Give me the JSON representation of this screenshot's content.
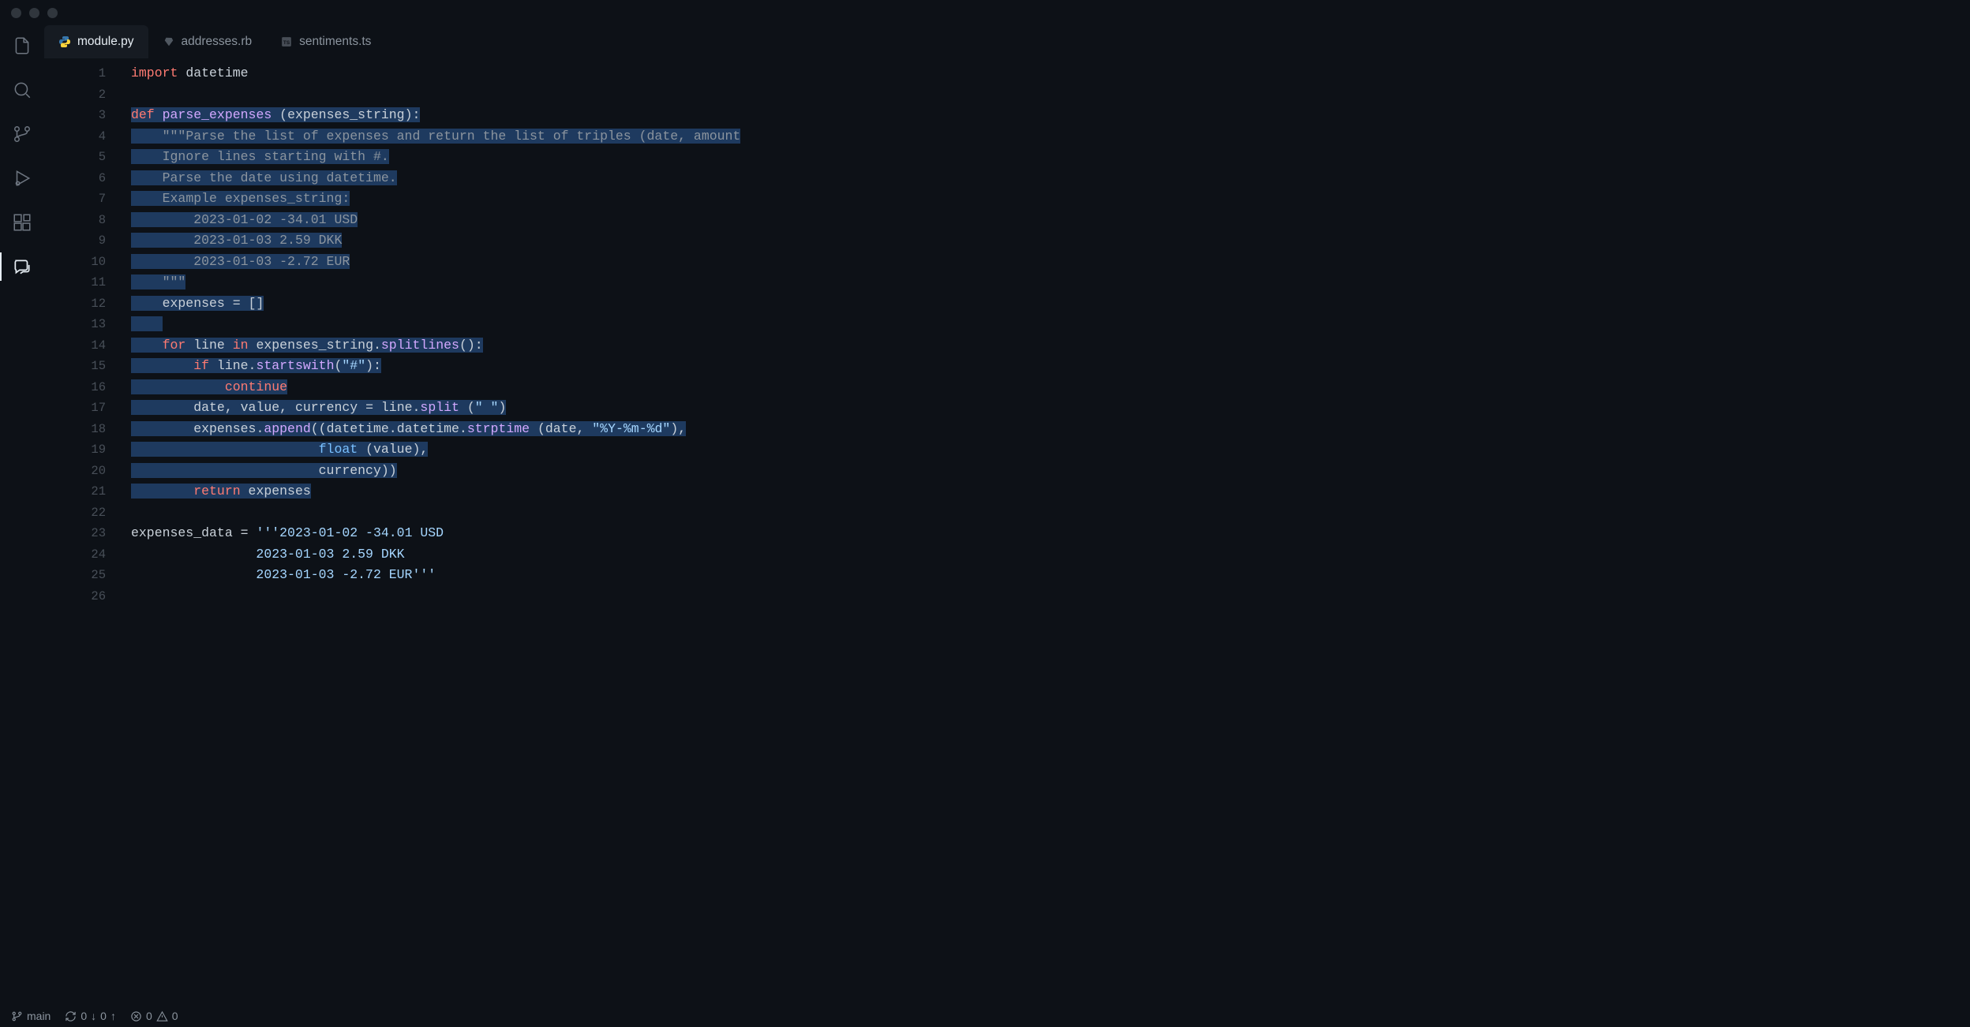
{
  "tabs": [
    {
      "label": "module.py",
      "icon": "python",
      "active": true
    },
    {
      "label": "addresses.rb",
      "icon": "ruby",
      "active": false
    },
    {
      "label": "sentiments.ts",
      "icon": "typescript",
      "active": false
    }
  ],
  "activity": {
    "items": [
      "files",
      "search",
      "source-control",
      "debug",
      "extensions",
      "chat"
    ],
    "active": "chat"
  },
  "code": {
    "lines": [
      {
        "n": 1,
        "sel": false,
        "tokens": [
          [
            "kw",
            "import"
          ],
          [
            "id",
            " datetime"
          ]
        ]
      },
      {
        "n": 2,
        "sel": false,
        "tokens": []
      },
      {
        "n": 3,
        "sel": true,
        "tokens": [
          [
            "kw",
            "def"
          ],
          [
            "id",
            " "
          ],
          [
            "def",
            "parse_expenses"
          ],
          [
            "id",
            " "
          ],
          [
            "op",
            "("
          ],
          [
            "id",
            "expenses_string"
          ],
          [
            "op",
            "):"
          ]
        ]
      },
      {
        "n": 4,
        "sel": true,
        "tokens": [
          [
            "id",
            "    "
          ],
          [
            "docstr",
            "\"\"\"Parse the list of expenses and return the list of triples (date, amount"
          ]
        ]
      },
      {
        "n": 5,
        "sel": true,
        "tokens": [
          [
            "id",
            "    "
          ],
          [
            "docstr",
            "Ignore lines starting with #."
          ]
        ]
      },
      {
        "n": 6,
        "sel": true,
        "tokens": [
          [
            "id",
            "    "
          ],
          [
            "docstr",
            "Parse the date using datetime."
          ]
        ]
      },
      {
        "n": 7,
        "sel": true,
        "tokens": [
          [
            "id",
            "    "
          ],
          [
            "docstr",
            "Example expenses_string:"
          ]
        ]
      },
      {
        "n": 8,
        "sel": true,
        "tokens": [
          [
            "id",
            "        "
          ],
          [
            "docstr",
            "2023-01-02 -34.01 USD"
          ]
        ]
      },
      {
        "n": 9,
        "sel": true,
        "tokens": [
          [
            "id",
            "        "
          ],
          [
            "docstr",
            "2023-01-03 2.59 DKK"
          ]
        ]
      },
      {
        "n": 10,
        "sel": true,
        "tokens": [
          [
            "id",
            "        "
          ],
          [
            "docstr",
            "2023-01-03 -2.72 EUR"
          ]
        ]
      },
      {
        "n": 11,
        "sel": true,
        "tokens": [
          [
            "id",
            "    "
          ],
          [
            "docstr",
            "\"\"\""
          ]
        ]
      },
      {
        "n": 12,
        "sel": true,
        "tokens": [
          [
            "id",
            "    expenses "
          ],
          [
            "op",
            "="
          ],
          [
            "id",
            " "
          ],
          [
            "op",
            "[]"
          ]
        ]
      },
      {
        "n": 13,
        "sel": true,
        "tokens": [
          [
            "id",
            "    "
          ]
        ]
      },
      {
        "n": 14,
        "sel": true,
        "tokens": [
          [
            "id",
            "    "
          ],
          [
            "kw",
            "for"
          ],
          [
            "id",
            " line "
          ],
          [
            "kw",
            "in"
          ],
          [
            "id",
            " expenses_string"
          ],
          [
            "op",
            "."
          ],
          [
            "fn",
            "splitlines"
          ],
          [
            "op",
            "():"
          ]
        ]
      },
      {
        "n": 15,
        "sel": true,
        "tokens": [
          [
            "id",
            "        "
          ],
          [
            "kw",
            "if"
          ],
          [
            "id",
            " line"
          ],
          [
            "op",
            "."
          ],
          [
            "fn",
            "startswith"
          ],
          [
            "op",
            "("
          ],
          [
            "str",
            "\"#\""
          ],
          [
            "op",
            "):"
          ]
        ]
      },
      {
        "n": 16,
        "sel": true,
        "tokens": [
          [
            "id",
            "            "
          ],
          [
            "kw",
            "continue"
          ]
        ]
      },
      {
        "n": 17,
        "sel": true,
        "tokens": [
          [
            "id",
            "        date"
          ],
          [
            "op",
            ","
          ],
          [
            "id",
            " value"
          ],
          [
            "op",
            ","
          ],
          [
            "id",
            " currency "
          ],
          [
            "op",
            "="
          ],
          [
            "id",
            " line"
          ],
          [
            "op",
            "."
          ],
          [
            "fn",
            "split"
          ],
          [
            "id",
            " "
          ],
          [
            "op",
            "("
          ],
          [
            "str",
            "\" \""
          ],
          [
            "op",
            ")"
          ]
        ]
      },
      {
        "n": 18,
        "sel": true,
        "tokens": [
          [
            "id",
            "        expenses"
          ],
          [
            "op",
            "."
          ],
          [
            "fn",
            "append"
          ],
          [
            "op",
            "(("
          ],
          [
            "id",
            "datetime"
          ],
          [
            "op",
            "."
          ],
          [
            "id",
            "datetime"
          ],
          [
            "op",
            "."
          ],
          [
            "fn",
            "strptime"
          ],
          [
            "id",
            " "
          ],
          [
            "op",
            "("
          ],
          [
            "id",
            "date"
          ],
          [
            "op",
            ", "
          ],
          [
            "str",
            "\"%Y-%m-%d\""
          ],
          [
            "op",
            "),"
          ]
        ]
      },
      {
        "n": 19,
        "sel": true,
        "tokens": [
          [
            "id",
            "                        "
          ],
          [
            "builtin",
            "float"
          ],
          [
            "id",
            " "
          ],
          [
            "op",
            "("
          ],
          [
            "id",
            "value"
          ],
          [
            "op",
            "),"
          ]
        ]
      },
      {
        "n": 20,
        "sel": true,
        "tokens": [
          [
            "id",
            "                        currency"
          ],
          [
            "op",
            "))"
          ]
        ]
      },
      {
        "n": 21,
        "sel": true,
        "tokens": [
          [
            "id",
            "        "
          ],
          [
            "kw",
            "return"
          ],
          [
            "id",
            " expenses"
          ]
        ]
      },
      {
        "n": 22,
        "sel": false,
        "tokens": []
      },
      {
        "n": 23,
        "sel": false,
        "tokens": [
          [
            "id",
            "expenses_data "
          ],
          [
            "op",
            "="
          ],
          [
            "id",
            " "
          ],
          [
            "str",
            "'''2023-01-02 -34.01 USD"
          ]
        ]
      },
      {
        "n": 24,
        "sel": false,
        "tokens": [
          [
            "str",
            "                2023-01-03 2.59 DKK"
          ]
        ]
      },
      {
        "n": 25,
        "sel": false,
        "tokens": [
          [
            "str",
            "                2023-01-03 -2.72 EUR'''"
          ]
        ]
      },
      {
        "n": 26,
        "sel": false,
        "tokens": []
      }
    ]
  },
  "status": {
    "branch": "main",
    "sync_down": "0",
    "sync_up": "0",
    "errors": "0",
    "warnings": "0"
  }
}
